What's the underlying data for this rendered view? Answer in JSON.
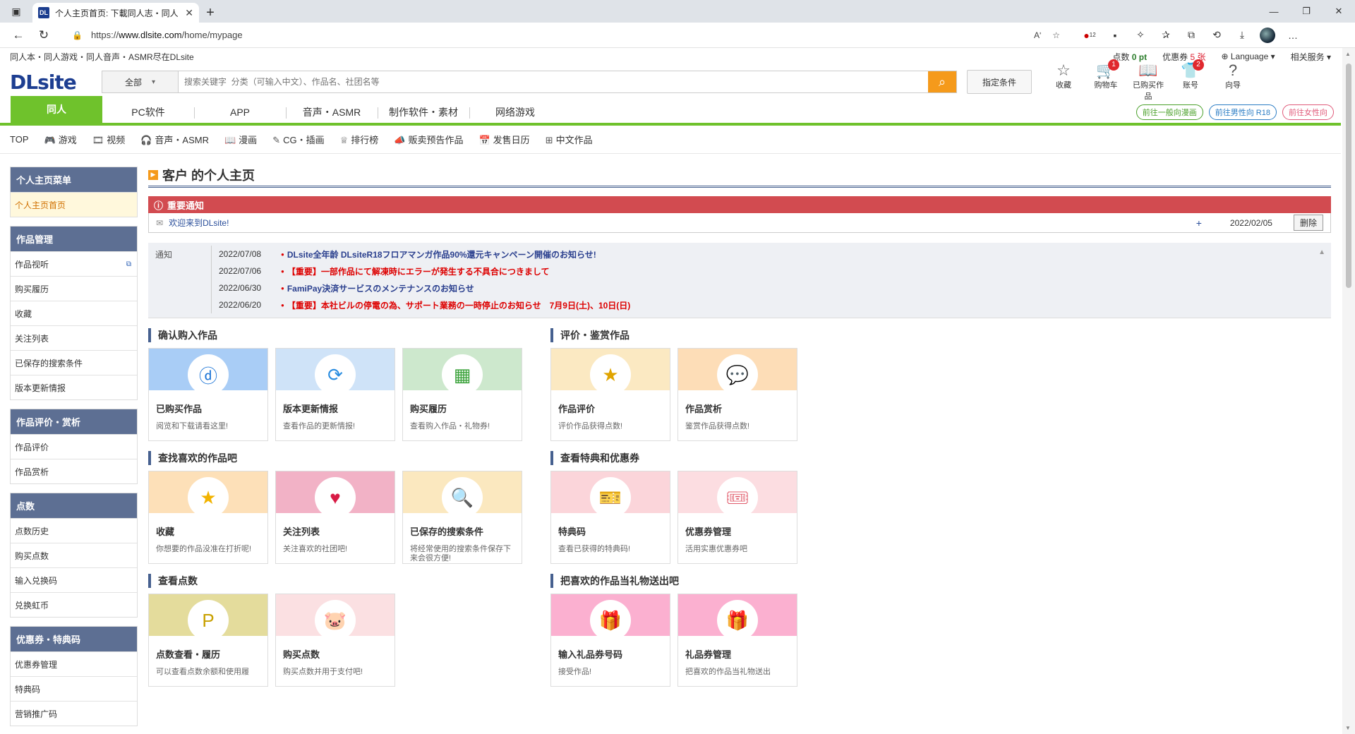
{
  "browser": {
    "tab_title": "个人主页首页: 下載同人志・同人",
    "favicon_text": "DL",
    "url_prefix": "https://",
    "url_domain": "www.dlsite.com",
    "url_path": "/home/mypage",
    "reader_mode": "Aʹ",
    "ext_badge": "12"
  },
  "topstrip": {
    "tagline": "同人本・同人游戏・同人音声・ASMR尽在DLsite",
    "points_label": "点数",
    "points_value": "0 pt",
    "coupon_label": "优惠券",
    "coupon_value": "5 张",
    "language": "Language",
    "services": "相关服务"
  },
  "header": {
    "logo": "DLsite",
    "search_category": "全部",
    "search_placeholder": "搜索关键字  分类（可输入中文）、作品名、社团名等",
    "condition_button": "指定条件",
    "icons": [
      {
        "label": "收藏",
        "icon": "☆",
        "badge": ""
      },
      {
        "label": "购物车",
        "icon": "🛒",
        "badge": "1"
      },
      {
        "label": "已购买作品",
        "icon": "📖",
        "badge": ""
      },
      {
        "label": "账号",
        "icon": "👕",
        "badge": "2"
      },
      {
        "label": "向导",
        "icon": "?",
        "badge": ""
      }
    ]
  },
  "mainnav": {
    "items": [
      "同人",
      "PC软件",
      "APP",
      "音声・ASMR",
      "制作软件・素材",
      "网络游戏"
    ],
    "switch": [
      "前往一般向漫画",
      "前往男性向 R18",
      "前往女性向"
    ]
  },
  "subnav": [
    "TOP",
    "游戏",
    "视频",
    "音声・ASMR",
    "漫画",
    "CG・插画",
    "排行榜",
    "贩卖预告作品",
    "发售日历",
    "中文作品"
  ],
  "sidebar": [
    {
      "head": "个人主页菜单",
      "items": [
        "个人主页首页"
      ]
    },
    {
      "head": "作品管理",
      "items": [
        "作品视听",
        "购买履历",
        "收藏",
        "关注列表",
        "已保存的搜索条件",
        "版本更新情报"
      ]
    },
    {
      "head": "作品评价・赏析",
      "items": [
        "作品评价",
        "作品赏析"
      ]
    },
    {
      "head": "点数",
      "items": [
        "点数历史",
        "购买点数",
        "输入兑换码",
        "兑换虹币"
      ]
    },
    {
      "head": "优惠券・特典码",
      "items": [
        "优惠券管理",
        "特典码",
        "营销推广码"
      ]
    }
  ],
  "page": {
    "title": "客户 的个人主页",
    "notice_head": "重要通知",
    "notice_msg": "欢迎来到DLsite!",
    "notice_date": "2022/02/05",
    "notice_delete": "删除",
    "news_label": "通知",
    "news": [
      {
        "date": "2022/07/08",
        "text": "DLsite全年龄 DLsiteR18フロアマンガ作品90%還元キャンペーン開催のお知らせ!",
        "red": false
      },
      {
        "date": "2022/07/06",
        "text": "【重要】一部作品にて解凍時にエラーが発生する不具合につきまして",
        "red": true
      },
      {
        "date": "2022/06/30",
        "text": "FamiPay決済サービスのメンテナンスのお知らせ",
        "red": false
      },
      {
        "date": "2022/06/20",
        "text": "【重要】本社ビルの停電の為、サポート業務の一時停止のお知らせ　7月9日(土)、10日(日)",
        "red": true
      }
    ]
  },
  "sections": [
    {
      "title": "确认购入作品",
      "cards": [
        {
          "title": "已购买作品",
          "desc": "阅览和下载请看这里!",
          "icon": "ⓓ",
          "bg": "#a9cdf6",
          "fg": "#1a73d6"
        },
        {
          "title": "版本更新情报",
          "desc": "查看作品的更新情报!",
          "icon": "⟳",
          "bg": "#cfe3f8",
          "fg": "#2a8de0"
        },
        {
          "title": "购买履历",
          "desc": "查看购入作品・礼物券!",
          "icon": "▦",
          "bg": "#cde8cd",
          "fg": "#3aa23a"
        }
      ]
    },
    {
      "title": "评价・鉴赏作品",
      "cards": [
        {
          "title": "作品评价",
          "desc": "评价作品获得点数!",
          "icon": "★",
          "bg": "#fbe9c2",
          "fg": "#e0a400"
        },
        {
          "title": "作品赏析",
          "desc": "鉴赏作品获得点数!",
          "icon": "💬",
          "bg": "#fdddb7",
          "fg": "#f08a1a"
        }
      ]
    },
    {
      "title": "查找喜欢的作品吧",
      "cards": [
        {
          "title": "收藏",
          "desc": "你想要的作品没准在打折呢!",
          "icon": "★",
          "bg": "#fde0b8",
          "fg": "#f2b300"
        },
        {
          "title": "关注列表",
          "desc": "关注喜欢的社团吧!",
          "icon": "♥",
          "bg": "#f2b2c6",
          "fg": "#d81b45"
        },
        {
          "title": "已保存的搜索条件",
          "desc": "将经常使用的搜索条件保存下来会很方便!",
          "icon": "🔍",
          "bg": "#fbe8bf",
          "fg": "#e0a400"
        }
      ]
    },
    {
      "title": "查看特典和优惠券",
      "cards": [
        {
          "title": "特典码",
          "desc": "查看已获得的特典码!",
          "icon": "🎫",
          "bg": "#fbd5da",
          "fg": "#e05a6a"
        },
        {
          "title": "优惠券管理",
          "desc": "活用实惠优惠券吧",
          "icon": "🎟",
          "bg": "#fcdde1",
          "fg": "#e05a6a"
        }
      ]
    },
    {
      "title": "查看点数",
      "cards": [
        {
          "title": "点数查看・履历",
          "desc": "可以查看点数余额和使用履",
          "icon": "P",
          "bg": "#e4dc9c",
          "fg": "#c8a000"
        },
        {
          "title": "购买点数",
          "desc": "购买点数并用于支付吧!",
          "icon": "🐷",
          "bg": "#fbe0e2",
          "fg": "#e88aa0"
        }
      ]
    },
    {
      "title": "把喜欢的作品当礼物送出吧",
      "cards": [
        {
          "title": "输入礼品券号码",
          "desc": "接受作品!",
          "icon": "🎁",
          "bg": "#fbb0d0",
          "fg": "#e0227a"
        },
        {
          "title": "礼品券管理",
          "desc": "把喜欢的作品当礼物送出",
          "icon": "🎁",
          "bg": "#fbb0d0",
          "fg": "#e0227a"
        }
      ]
    }
  ]
}
